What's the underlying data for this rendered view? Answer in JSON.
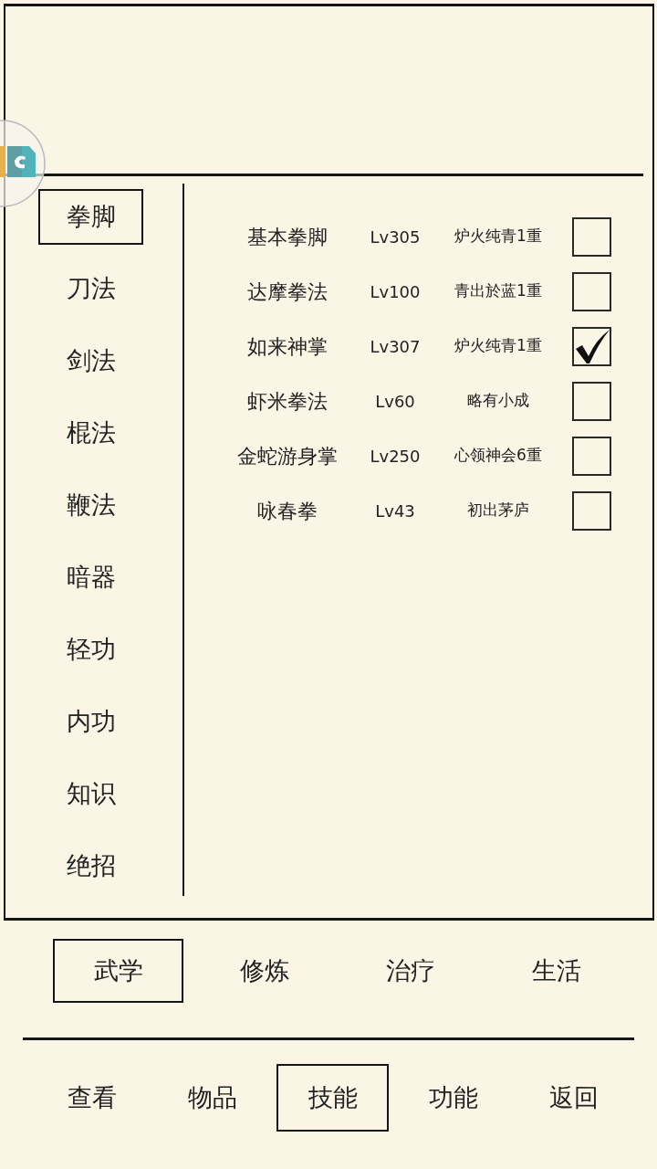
{
  "categories": [
    {
      "label": "拳脚",
      "selected": true
    },
    {
      "label": "刀法",
      "selected": false
    },
    {
      "label": "剑法",
      "selected": false
    },
    {
      "label": "棍法",
      "selected": false
    },
    {
      "label": "鞭法",
      "selected": false
    },
    {
      "label": "暗器",
      "selected": false
    },
    {
      "label": "轻功",
      "selected": false
    },
    {
      "label": "内功",
      "selected": false
    },
    {
      "label": "知识",
      "selected": false
    },
    {
      "label": "绝招",
      "selected": false
    }
  ],
  "skills": [
    {
      "name": "基本拳脚",
      "level_text": "Lv305",
      "realm": "炉火纯青1重",
      "checked": false
    },
    {
      "name": "达摩拳法",
      "level_text": "Lv100",
      "realm": "青出於蓝1重",
      "checked": false
    },
    {
      "name": "如来神掌",
      "level_text": "Lv307",
      "realm": "炉火纯青1重",
      "checked": true
    },
    {
      "name": "虾米拳法",
      "level_text": "Lv60",
      "realm": "略有小成",
      "checked": false
    },
    {
      "name": "金蛇游身掌",
      "level_text": "Lv250",
      "realm": "心领神会6重",
      "checked": false
    },
    {
      "name": "咏春拳",
      "level_text": "Lv43",
      "realm": "初出茅庐",
      "checked": false
    }
  ],
  "section_tabs": [
    {
      "label": "武学",
      "selected": true
    },
    {
      "label": "修炼",
      "selected": false
    },
    {
      "label": "治疗",
      "selected": false
    },
    {
      "label": "生活",
      "selected": false
    }
  ],
  "nav_tabs": [
    {
      "label": "查看",
      "selected": false
    },
    {
      "label": "物品",
      "selected": false
    },
    {
      "label": "技能",
      "selected": true
    },
    {
      "label": "功能",
      "selected": false
    },
    {
      "label": "返回",
      "selected": false
    }
  ]
}
